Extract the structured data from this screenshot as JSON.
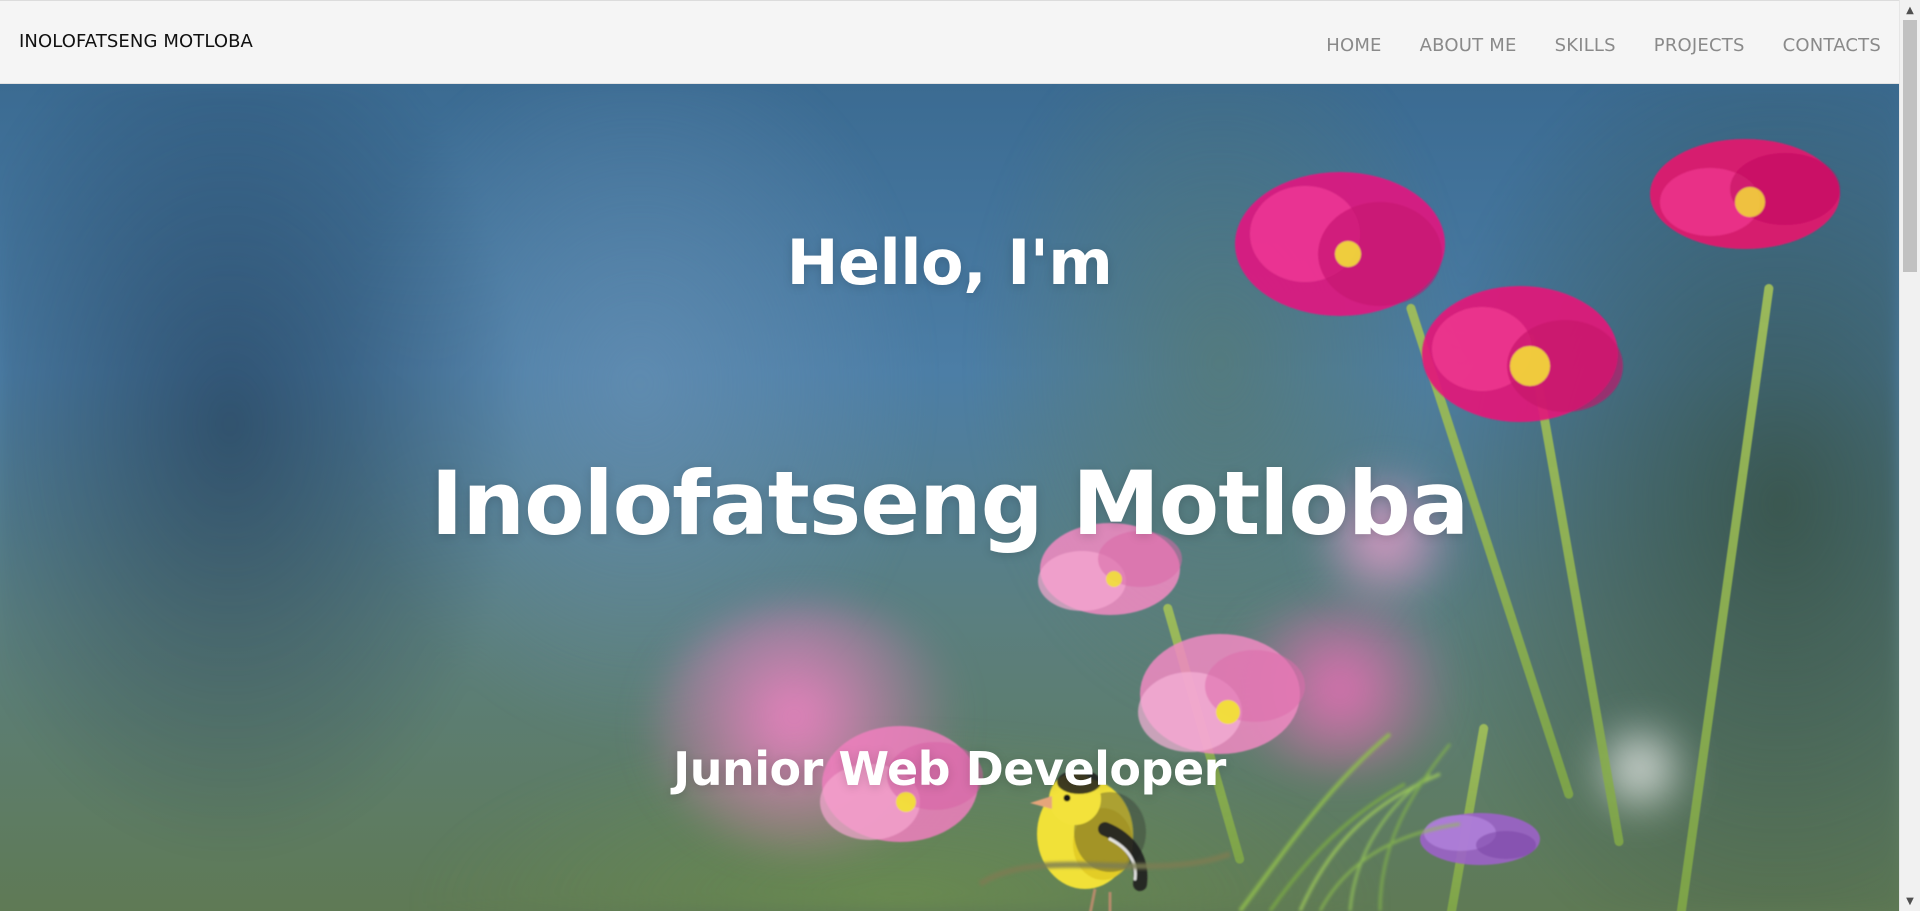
{
  "brand": {
    "text": "INOLOFATSENG MOTLOBA"
  },
  "nav": {
    "items": [
      {
        "label": "HOME"
      },
      {
        "label": "ABOUT ME"
      },
      {
        "label": "SKILLS"
      },
      {
        "label": "PROJECTS"
      },
      {
        "label": "CONTACTS"
      }
    ]
  },
  "hero": {
    "greeting": "Hello, I'm",
    "name": "Inolofatseng Motloba",
    "role": "Junior Web Developer"
  },
  "scrollbar": {
    "up_icon": "triangle-up-icon",
    "down_icon": "triangle-down-icon",
    "up_glyph": "▲",
    "down_glyph": "▼"
  },
  "colors": {
    "nav_bg": "#f5f5f5",
    "nav_link": "#8a8a8a",
    "brand": "#111111",
    "hero_text": "#ffffff",
    "accent_magenta": "#e2187a",
    "accent_pink": "#ef8ac0",
    "accent_yellow": "#f2e037"
  }
}
